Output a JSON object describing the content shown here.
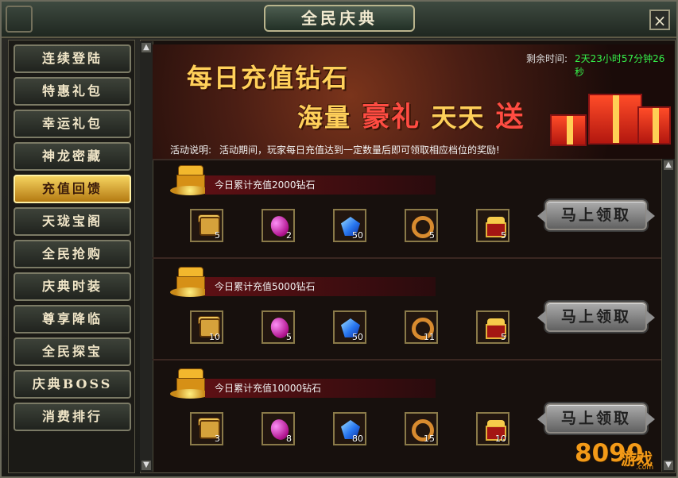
{
  "window": {
    "title": "全民庆典"
  },
  "nav": [
    "连续登陆",
    "特惠礼包",
    "幸运礼包",
    "神龙密藏",
    "充值回馈",
    "天珑宝阁",
    "全民抢购",
    "庆典时装",
    "尊享降临",
    "全民探宝",
    "庆典BOSS",
    "消费排行"
  ],
  "banner": {
    "headline1": "每日充值钻石",
    "headline2_prefix": "海量",
    "headline2_highlight": "豪礼",
    "headline2_mid": "天天",
    "headline2_end": "送",
    "timer_label": "剩余时间:",
    "timer_value": "2天23小时57分钟26秒",
    "desc_label": "活动说明:",
    "desc_text": "活动期间，玩家每日充值达到一定数量后即可领取相应档位的奖励!"
  },
  "rewards": [
    {
      "title": "今日累计充值2000钻石",
      "counts": [
        "5",
        "2",
        "50",
        "5",
        "5"
      ],
      "claim": "马上领取"
    },
    {
      "title": "今日累计充值5000钻石",
      "counts": [
        "10",
        "5",
        "50",
        "11",
        "5"
      ],
      "claim": "马上领取"
    },
    {
      "title": "今日累计充值10000钻石",
      "counts": [
        "3",
        "8",
        "80",
        "15",
        "10"
      ],
      "claim": "马上领取"
    }
  ],
  "watermark": {
    "num": "8090",
    "game": "游戏",
    "site": ".com"
  },
  "colors": {
    "accent": "#ffd05a",
    "highlight": "#ff4c42",
    "timer": "#35f14a"
  }
}
